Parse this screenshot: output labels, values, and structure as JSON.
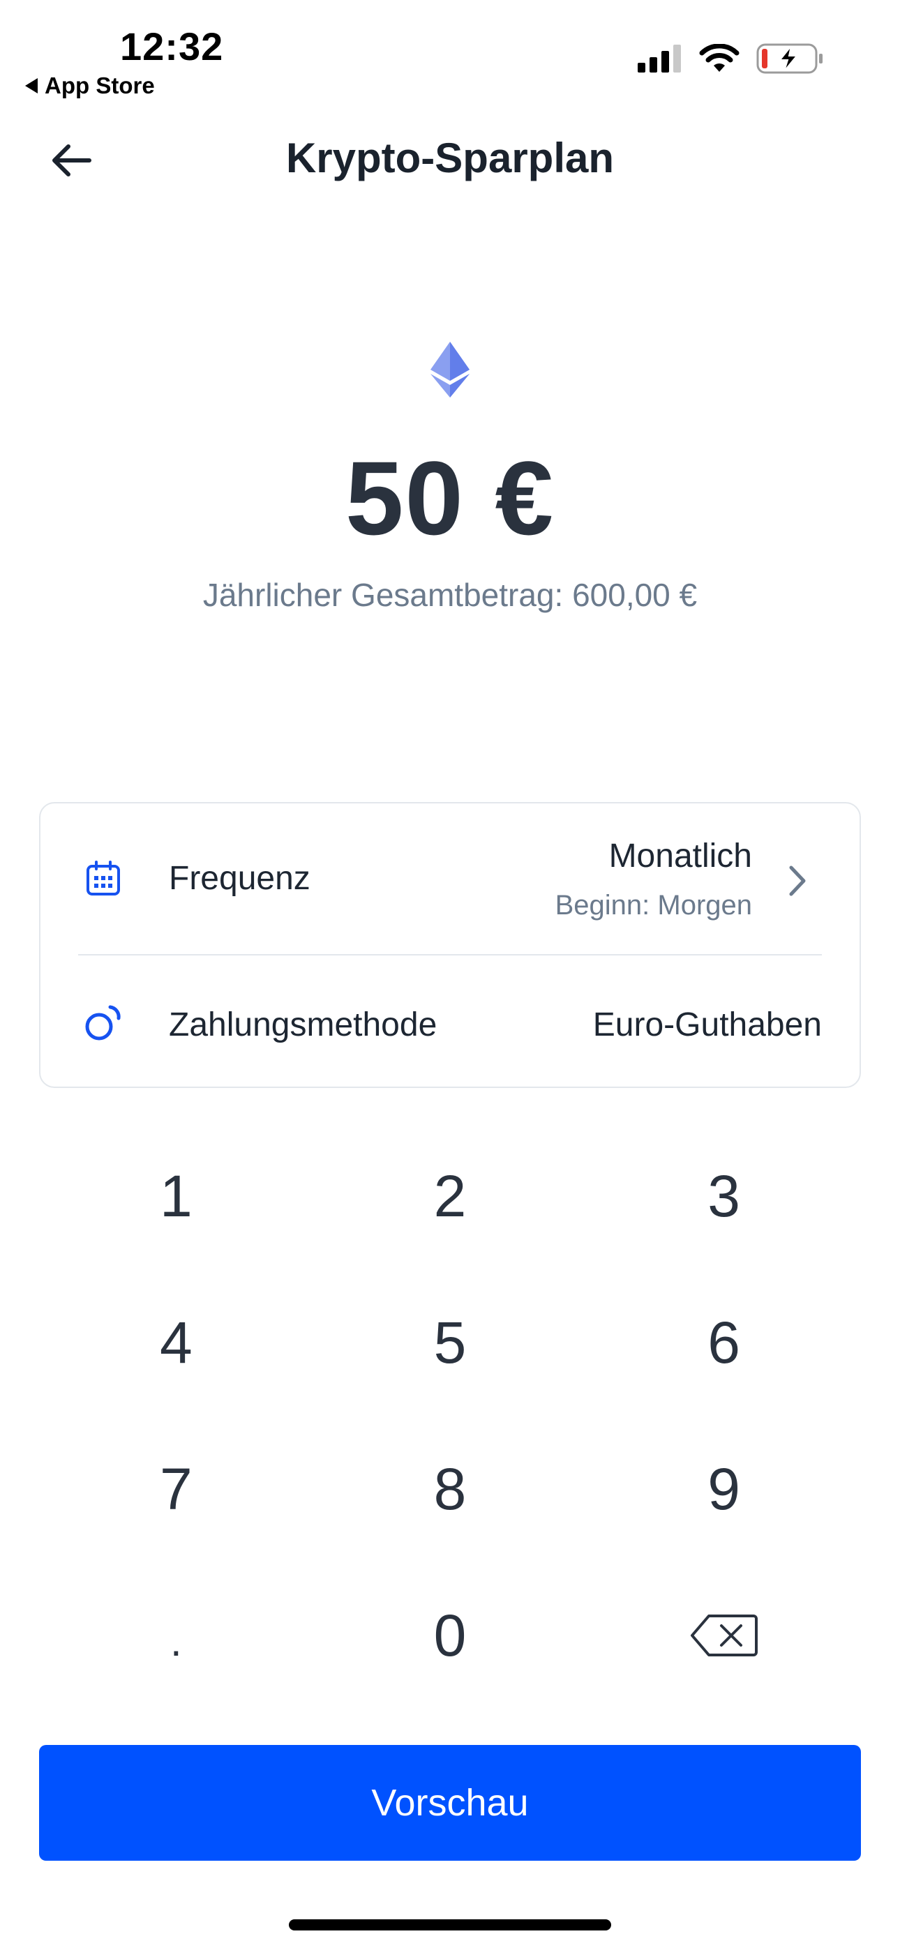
{
  "status_bar": {
    "time": "12:32",
    "back_app": "App Store",
    "icons": [
      "cellular-signal-icon",
      "wifi-icon",
      "battery-charging-icon"
    ]
  },
  "header": {
    "title": "Krypto-Sparplan",
    "back_icon": "arrow-left-icon"
  },
  "amount": {
    "asset_icon": "ethereum-icon",
    "value": "50 €",
    "yearly_total": "Jährlicher Gesamtbetrag: 600,00 €"
  },
  "settings": {
    "frequency": {
      "icon": "calendar-icon",
      "label": "Frequenz",
      "value": "Monatlich",
      "sub": "Beginn: Morgen"
    },
    "payment": {
      "icon": "payment-method-icon",
      "label": "Zahlungsmethode",
      "value": "Euro-Guthaben"
    }
  },
  "keypad": {
    "keys": [
      "1",
      "2",
      "3",
      "4",
      "5",
      "6",
      "7",
      "8",
      "9",
      ".",
      "0"
    ],
    "backspace_icon": "backspace-icon"
  },
  "cta": {
    "label": "Vorschau"
  },
  "colors": {
    "primary": "#0052ff",
    "text": "#1d2632",
    "muted": "#6b7a8c",
    "border": "#e3e7ec",
    "ethereum": "#627eea"
  }
}
